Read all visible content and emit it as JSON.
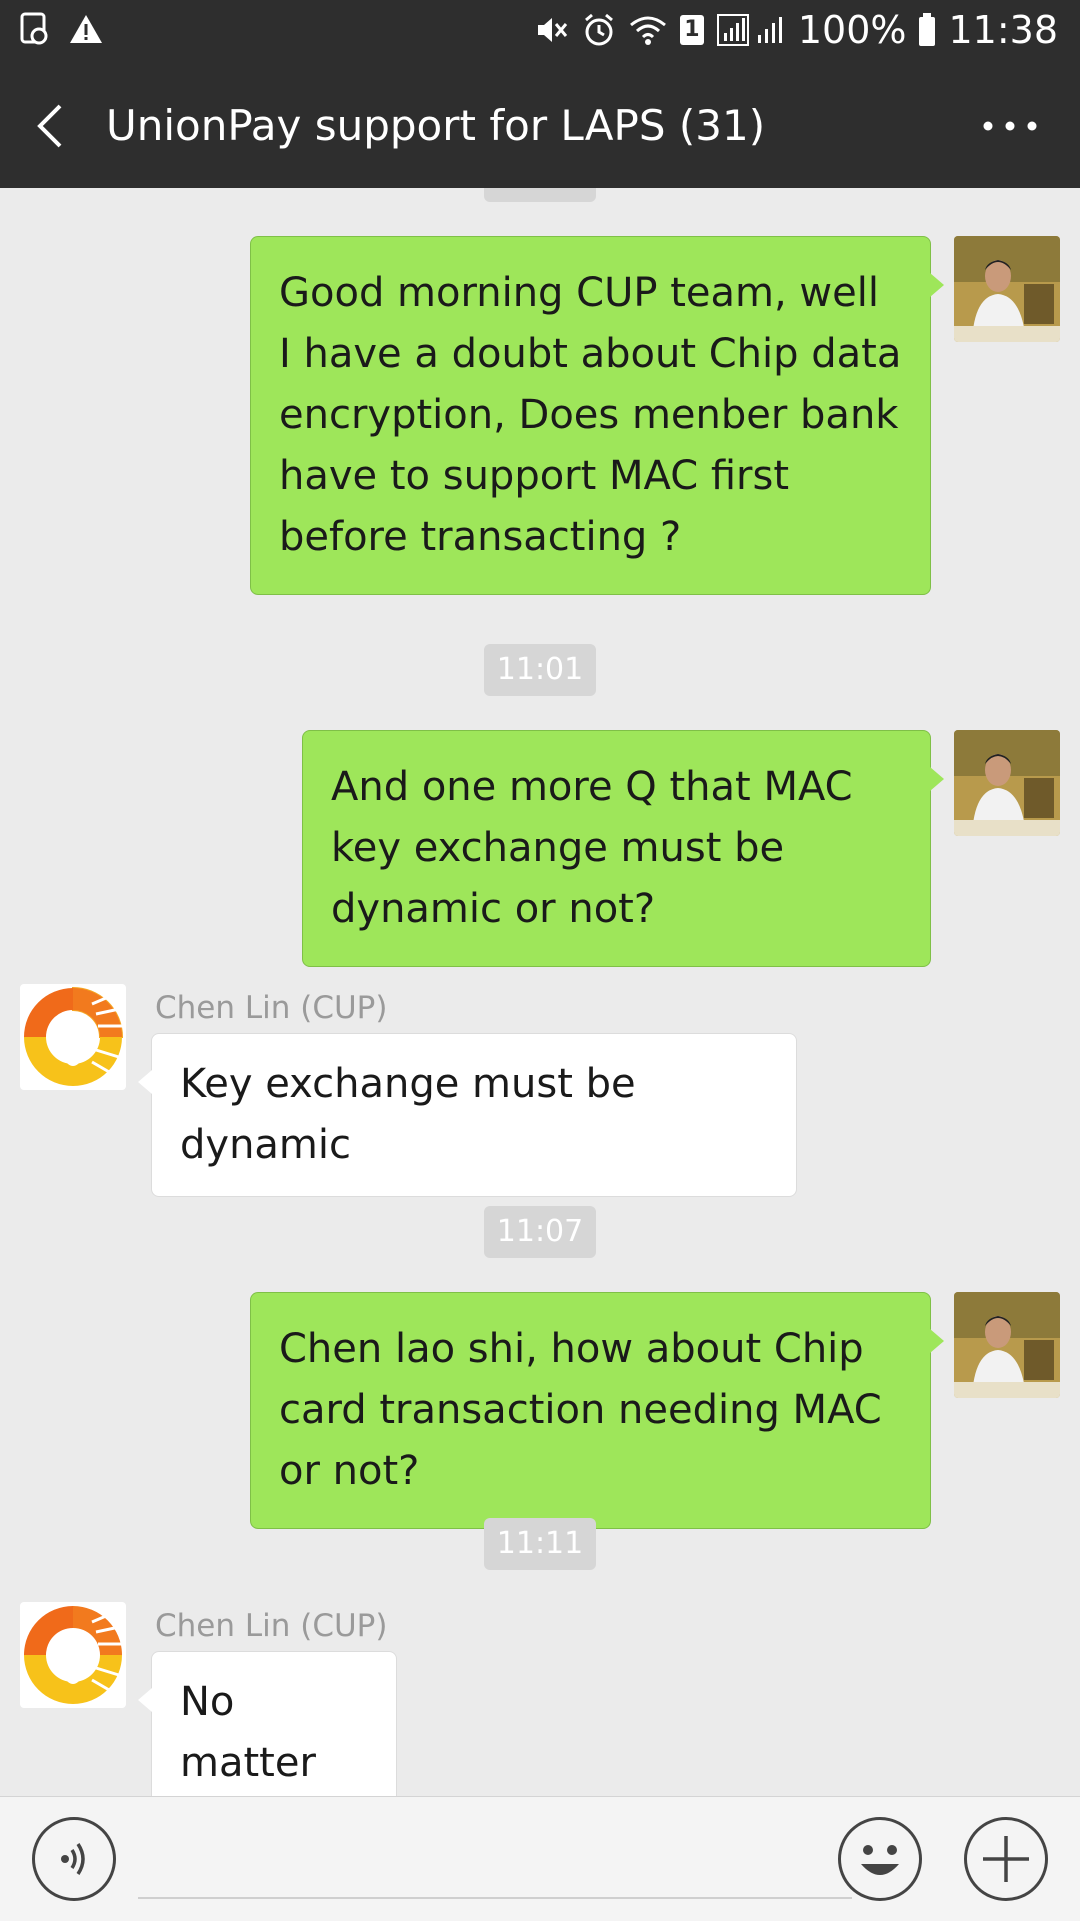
{
  "status_bar": {
    "battery": "100%",
    "time": "11:38",
    "sim_badge": "1"
  },
  "header": {
    "title": "UnionPay support for LAPS (31)",
    "back_icon": "chevron-left-icon",
    "more_icon": "more-dots-icon"
  },
  "messages": [
    {
      "type": "outgoing",
      "text": "Good morning CUP team, well I have a doubt about Chip data encryption, Does menber bank have to support MAC first before transacting ?"
    },
    {
      "type": "time",
      "text": "11:01"
    },
    {
      "type": "outgoing",
      "text": "And one more Q that MAC key exchange must be dynamic or not?"
    },
    {
      "type": "incoming",
      "sender": "Chen Lin (CUP)",
      "text": "Key exchange must be dynamic"
    },
    {
      "type": "time",
      "text": "11:07"
    },
    {
      "type": "outgoing",
      "text": "Chen lao shi, how about Chip card transaction needing MAC or not?"
    },
    {
      "type": "time",
      "text": "11:11"
    },
    {
      "type": "incoming",
      "sender": "Chen Lin (CUP)",
      "text": "No matter"
    }
  ],
  "input_bar": {
    "voice_icon": "voice-icon",
    "emoji_icon": "emoji-icon",
    "plus_icon": "plus-icon",
    "message_value": ""
  },
  "colors": {
    "header_bg": "#2e2e2e",
    "chat_bg": "#ebebeb",
    "outgoing_bubble": "#9ee65a",
    "incoming_bubble": "#ffffff",
    "timestamp_bg": "#d6d6d6"
  }
}
